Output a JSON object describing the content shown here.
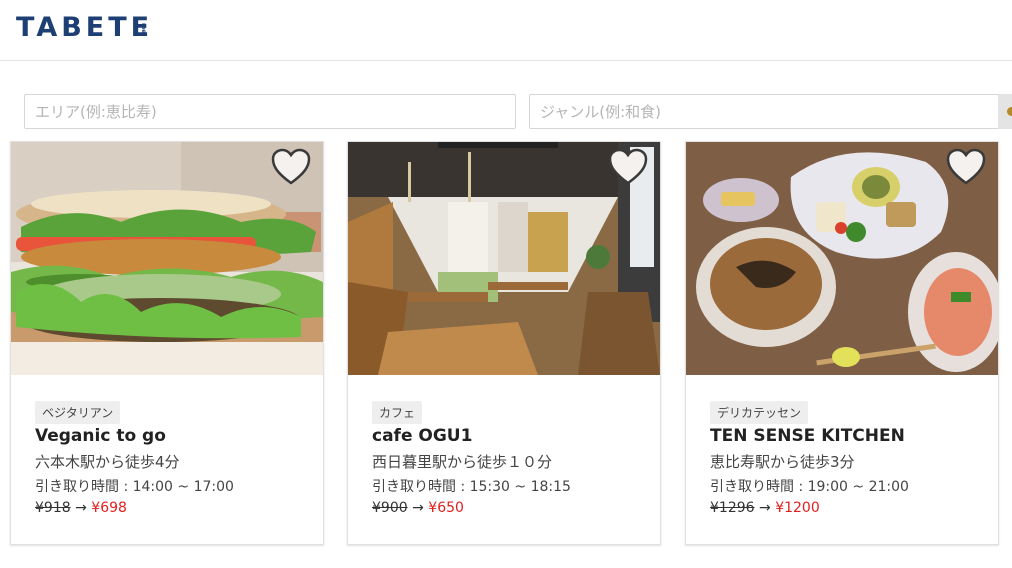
{
  "header": {
    "logo": "TABETE",
    "logo_sub": "me"
  },
  "search": {
    "area_placeholder": "エリア(例:恵比寿)",
    "genre_placeholder": "ジャンル(例:和食)"
  },
  "cards": [
    {
      "category": "ベジタリアン",
      "name": "Veganic to go",
      "access": "六本木駅から徒歩4分",
      "pickup": "引き取り時間 : 14:00 ~ 17:00",
      "old_price": "¥918",
      "arrow": "→",
      "new_price": "¥698"
    },
    {
      "category": "カフェ",
      "name": "cafe OGU1",
      "access": "西日暮里駅から徒歩１０分",
      "pickup": "引き取り時間 : 15:30 ~ 18:15",
      "old_price": "¥900",
      "arrow": "→",
      "new_price": "¥650"
    },
    {
      "category": "デリカテッセン",
      "name": "TEN SENSE KITCHEN",
      "access": "恵比寿駅から徒歩3分",
      "pickup": "引き取り時間 : 19:00 ~ 21:00",
      "old_price": "¥1296",
      "arrow": "→",
      "new_price": "¥1200"
    }
  ],
  "colors": {
    "brand": "#1d3f73",
    "sale_price": "#e02020"
  }
}
